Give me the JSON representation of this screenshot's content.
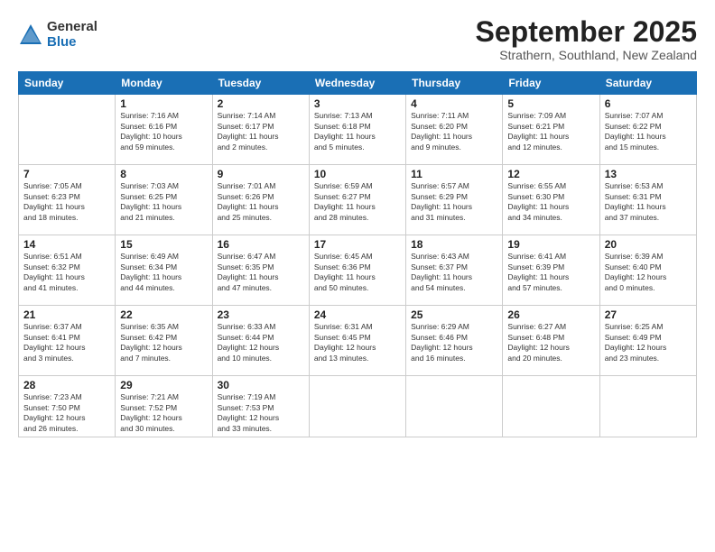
{
  "logo": {
    "general": "General",
    "blue": "Blue"
  },
  "header": {
    "month": "September 2025",
    "location": "Strathern, Southland, New Zealand"
  },
  "days_of_week": [
    "Sunday",
    "Monday",
    "Tuesday",
    "Wednesday",
    "Thursday",
    "Friday",
    "Saturday"
  ],
  "weeks": [
    [
      {
        "day": "",
        "info": ""
      },
      {
        "day": "1",
        "info": "Sunrise: 7:16 AM\nSunset: 6:16 PM\nDaylight: 10 hours\nand 59 minutes."
      },
      {
        "day": "2",
        "info": "Sunrise: 7:14 AM\nSunset: 6:17 PM\nDaylight: 11 hours\nand 2 minutes."
      },
      {
        "day": "3",
        "info": "Sunrise: 7:13 AM\nSunset: 6:18 PM\nDaylight: 11 hours\nand 5 minutes."
      },
      {
        "day": "4",
        "info": "Sunrise: 7:11 AM\nSunset: 6:20 PM\nDaylight: 11 hours\nand 9 minutes."
      },
      {
        "day": "5",
        "info": "Sunrise: 7:09 AM\nSunset: 6:21 PM\nDaylight: 11 hours\nand 12 minutes."
      },
      {
        "day": "6",
        "info": "Sunrise: 7:07 AM\nSunset: 6:22 PM\nDaylight: 11 hours\nand 15 minutes."
      }
    ],
    [
      {
        "day": "7",
        "info": "Sunrise: 7:05 AM\nSunset: 6:23 PM\nDaylight: 11 hours\nand 18 minutes."
      },
      {
        "day": "8",
        "info": "Sunrise: 7:03 AM\nSunset: 6:25 PM\nDaylight: 11 hours\nand 21 minutes."
      },
      {
        "day": "9",
        "info": "Sunrise: 7:01 AM\nSunset: 6:26 PM\nDaylight: 11 hours\nand 25 minutes."
      },
      {
        "day": "10",
        "info": "Sunrise: 6:59 AM\nSunset: 6:27 PM\nDaylight: 11 hours\nand 28 minutes."
      },
      {
        "day": "11",
        "info": "Sunrise: 6:57 AM\nSunset: 6:29 PM\nDaylight: 11 hours\nand 31 minutes."
      },
      {
        "day": "12",
        "info": "Sunrise: 6:55 AM\nSunset: 6:30 PM\nDaylight: 11 hours\nand 34 minutes."
      },
      {
        "day": "13",
        "info": "Sunrise: 6:53 AM\nSunset: 6:31 PM\nDaylight: 11 hours\nand 37 minutes."
      }
    ],
    [
      {
        "day": "14",
        "info": "Sunrise: 6:51 AM\nSunset: 6:32 PM\nDaylight: 11 hours\nand 41 minutes."
      },
      {
        "day": "15",
        "info": "Sunrise: 6:49 AM\nSunset: 6:34 PM\nDaylight: 11 hours\nand 44 minutes."
      },
      {
        "day": "16",
        "info": "Sunrise: 6:47 AM\nSunset: 6:35 PM\nDaylight: 11 hours\nand 47 minutes."
      },
      {
        "day": "17",
        "info": "Sunrise: 6:45 AM\nSunset: 6:36 PM\nDaylight: 11 hours\nand 50 minutes."
      },
      {
        "day": "18",
        "info": "Sunrise: 6:43 AM\nSunset: 6:37 PM\nDaylight: 11 hours\nand 54 minutes."
      },
      {
        "day": "19",
        "info": "Sunrise: 6:41 AM\nSunset: 6:39 PM\nDaylight: 11 hours\nand 57 minutes."
      },
      {
        "day": "20",
        "info": "Sunrise: 6:39 AM\nSunset: 6:40 PM\nDaylight: 12 hours\nand 0 minutes."
      }
    ],
    [
      {
        "day": "21",
        "info": "Sunrise: 6:37 AM\nSunset: 6:41 PM\nDaylight: 12 hours\nand 3 minutes."
      },
      {
        "day": "22",
        "info": "Sunrise: 6:35 AM\nSunset: 6:42 PM\nDaylight: 12 hours\nand 7 minutes."
      },
      {
        "day": "23",
        "info": "Sunrise: 6:33 AM\nSunset: 6:44 PM\nDaylight: 12 hours\nand 10 minutes."
      },
      {
        "day": "24",
        "info": "Sunrise: 6:31 AM\nSunset: 6:45 PM\nDaylight: 12 hours\nand 13 minutes."
      },
      {
        "day": "25",
        "info": "Sunrise: 6:29 AM\nSunset: 6:46 PM\nDaylight: 12 hours\nand 16 minutes."
      },
      {
        "day": "26",
        "info": "Sunrise: 6:27 AM\nSunset: 6:48 PM\nDaylight: 12 hours\nand 20 minutes."
      },
      {
        "day": "27",
        "info": "Sunrise: 6:25 AM\nSunset: 6:49 PM\nDaylight: 12 hours\nand 23 minutes."
      }
    ],
    [
      {
        "day": "28",
        "info": "Sunrise: 7:23 AM\nSunset: 7:50 PM\nDaylight: 12 hours\nand 26 minutes."
      },
      {
        "day": "29",
        "info": "Sunrise: 7:21 AM\nSunset: 7:52 PM\nDaylight: 12 hours\nand 30 minutes."
      },
      {
        "day": "30",
        "info": "Sunrise: 7:19 AM\nSunset: 7:53 PM\nDaylight: 12 hours\nand 33 minutes."
      },
      {
        "day": "",
        "info": ""
      },
      {
        "day": "",
        "info": ""
      },
      {
        "day": "",
        "info": ""
      },
      {
        "day": "",
        "info": ""
      }
    ]
  ]
}
